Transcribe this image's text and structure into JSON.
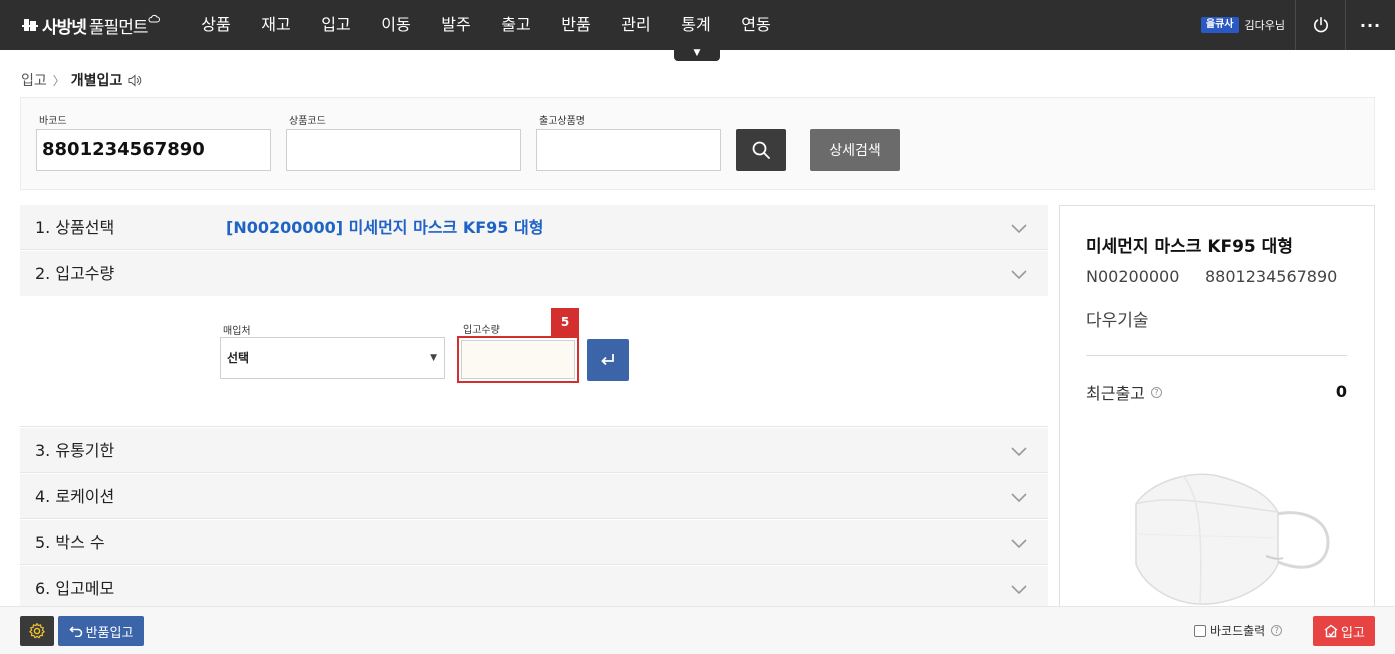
{
  "header": {
    "logo_bold": "사방넷",
    "logo_text": "풀필먼트",
    "nav": [
      "상품",
      "재고",
      "입고",
      "이동",
      "발주",
      "출고",
      "반품",
      "관리",
      "통계",
      "연동"
    ],
    "nav_toggle": "▼",
    "user_badge": "을큐사",
    "user_name": "김다우님",
    "more": "···"
  },
  "breadcrumb": {
    "parent": "입고",
    "separator": "〉",
    "current": "개별입고"
  },
  "search": {
    "barcode_label": "바코드",
    "barcode_value": "8801234567890",
    "product_code_label": "상품코드",
    "product_code_value": "",
    "outbound_name_label": "출고상품명",
    "outbound_name_value": "",
    "detail_search_label": "상세검색"
  },
  "steps": [
    {
      "title": "1. 상품선택",
      "value": "[N00200000] 미세먼지 마스크 KF95 대형"
    },
    {
      "title": "2. 입고수량",
      "value": ""
    },
    {
      "title": "3. 유통기한",
      "value": ""
    },
    {
      "title": "4. 로케이션",
      "value": ""
    },
    {
      "title": "5. 박스 수",
      "value": ""
    },
    {
      "title": "6. 입고메모",
      "value": ""
    }
  ],
  "quantity_form": {
    "supplier_label": "매입처",
    "supplier_selected": "선택",
    "quantity_label": "입고수량",
    "quantity_value": "",
    "step_badge": "5"
  },
  "product_panel": {
    "name": "미세먼지 마스크 KF95 대형",
    "code": "N00200000",
    "barcode": "8801234567890",
    "supplier": "다우기술",
    "recent_outbound_label": "최근출고",
    "recent_outbound_value": "0"
  },
  "footer": {
    "return_inbound_label": "반품입고",
    "barcode_print_label": "바코드출력",
    "inbound_label": "입고"
  },
  "colors": {
    "topbar": "#2f2f2f",
    "accent_blue": "#3c64a8",
    "link_blue": "#1f63c6",
    "danger_red": "#d32f2f",
    "inbound_red": "#e84343"
  }
}
